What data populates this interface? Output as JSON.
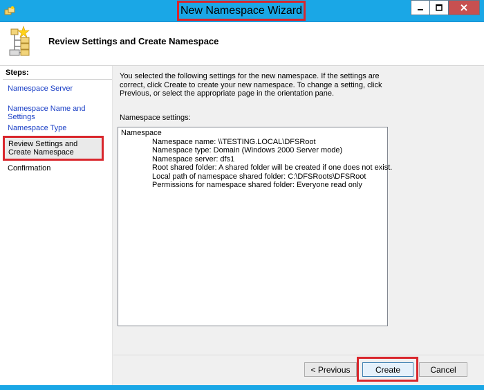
{
  "window": {
    "title": "New Namespace Wizard"
  },
  "header": {
    "title": "Review Settings and Create Namespace"
  },
  "steps": {
    "label": "Steps:",
    "items": [
      {
        "label": "Namespace Server"
      },
      {
        "label": "Namespace Name and Settings"
      },
      {
        "label": "Namespace Type"
      },
      {
        "label": "Review Settings and Create Namespace"
      },
      {
        "label": "Confirmation"
      }
    ]
  },
  "content": {
    "intro": "You selected the following settings for the new namespace. If the settings are correct, click Create to create your new namespace. To change a setting, click Previous, or select the appropriate page in the orientation pane.",
    "settings_label": "Namespace settings:",
    "settings_heading": "Namespace",
    "settings_lines": [
      "Namespace name: \\\\TESTING.LOCAL\\DFSRoot",
      "Namespace type:  Domain (Windows 2000 Server mode)",
      "Namespace server: dfs1",
      "Root shared folder:  A shared folder will be created if one does not exist.",
      "Local path of namespace shared folder: C:\\DFSRoots\\DFSRoot",
      "Permissions for namespace shared folder: Everyone read only"
    ]
  },
  "buttons": {
    "previous": "< Previous",
    "create": "Create",
    "cancel": "Cancel"
  },
  "colors": {
    "titlebar": "#1aa7e6",
    "highlight": "#d9262c",
    "link": "#1a3fc6"
  },
  "icons": {
    "app": "namespace-wizard-icon",
    "header": "namespace-tree-icon",
    "minimize": "minimize-icon",
    "maximize": "maximize-icon",
    "close": "close-icon"
  }
}
